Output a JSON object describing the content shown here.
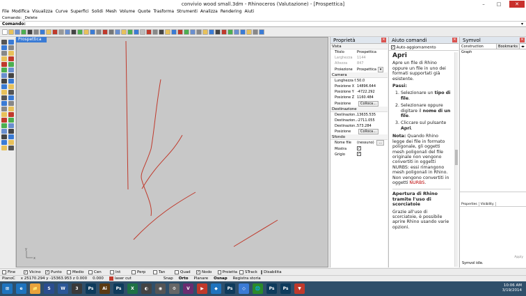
{
  "window": {
    "title": "convivio wood small.3dm - Rhinoceros (Valutazione) - [Prospettica]",
    "min": "–",
    "max": "□",
    "close": "✕"
  },
  "menu": [
    "File",
    "Modifica",
    "Visualizza",
    "Curve",
    "Superfici",
    "Solidi",
    "Mesh",
    "Volume",
    "Quote",
    "Trasforma",
    "Strumenti",
    "Analizza",
    "Rendering",
    "Aiuti"
  ],
  "command_history": [
    "Comando: _Delete"
  ],
  "command_prompt": "Comando:",
  "viewport": {
    "label": "Prospettica",
    "axis_y": "y",
    "axis_x": "x"
  },
  "proprieta": {
    "title": "Proprietà",
    "vista_label": "Vista",
    "vista_rows": [
      {
        "label": "Titolo",
        "value": "Prospettica",
        "disabled": false
      },
      {
        "label": "Larghezza",
        "value": "1144",
        "disabled": true
      },
      {
        "label": "Altezza",
        "value": "847",
        "disabled": true
      },
      {
        "label": "Proiezione",
        "value": "Prospettica",
        "disabled": false
      }
    ],
    "camera_label": "Camera",
    "camera_rows": [
      {
        "label": "Lunghezza f...",
        "value": "50.0"
      },
      {
        "label": "Posizione X",
        "value": "14896.644"
      },
      {
        "label": "Posizione Y",
        "value": "-4722.292"
      },
      {
        "label": "Posizione Z",
        "value": "1160.484"
      }
    ],
    "camera_pos_label": "Posizione",
    "colloca": "Colloca...",
    "destinazione_label": "Destinazione",
    "dest_rows": [
      {
        "label": "Destinazion...",
        "value": "13635.535"
      },
      {
        "label": "Destinazion...",
        "value": "-2711.055"
      },
      {
        "label": "Destinazion...",
        "value": "573.284"
      }
    ],
    "dest_pos_label": "Posizione",
    "sfondo_label": "Sfondo",
    "nome_file_label": "Nome file",
    "nome_file_value": "(nessuno)",
    "mostra_label": "Mostra",
    "grigio_label": "Grigio",
    "check": "✓",
    "dropdown": "▾",
    "browse": "..."
  },
  "aiuto": {
    "title": "Aiuto comandi",
    "auto_update": "Auto-aggiornamento",
    "heading": "Apri",
    "intro": "Apre un file di Rhino oppure un file in uno dei formati supportati già esistente.",
    "steps_label": "Passi:",
    "step1_a": "Selezionare un ",
    "step1_b": "tipo di file",
    "step1_c": ".",
    "step2_a": "Selezionare oppure digitare il ",
    "step2_b": "nome di un file",
    "step2_c": ".",
    "step3_a": "Cliccare sul pulsante ",
    "step3_b": "Apri",
    "step3_c": ".",
    "note_label": "Nota:",
    "note_text": " Quando Rhino legge dei file in formato poligonale, gli oggetti mesh poligonali del file originale non vengono convertiti in oggetti NURBS: essi rimangono mesh poligonali in Rhino. Non vengono convertiti in oggetti ",
    "note_nurbs": "NURBS",
    "note_end": ".",
    "section2": "Apertura di Rhino tramite l'uso di scorciatoie",
    "section2_text": "Grazie all'uso di scorciatoie, è possibile aprire Rhino usando varie opzioni."
  },
  "symvol": {
    "title": "Symvol",
    "tabs": [
      "Construction Graph",
      "Bookmarks"
    ],
    "sub_tabs": [
      "Properties",
      "Visibility"
    ],
    "apply": "Apply",
    "status": "Symvol idle."
  },
  "osnap": [
    {
      "label": "Fine",
      "checked": false
    },
    {
      "label": "Vicino",
      "checked": true
    },
    {
      "label": "Punto",
      "checked": true
    },
    {
      "label": "Medio",
      "checked": false
    },
    {
      "label": "Cen",
      "checked": false
    },
    {
      "label": "Int",
      "checked": false
    },
    {
      "label": "Perp",
      "checked": false
    },
    {
      "label": "Tan",
      "checked": false
    },
    {
      "label": "Quad",
      "checked": false
    },
    {
      "label": "Nodo",
      "checked": true
    },
    {
      "label": "Proietta",
      "checked": false
    },
    {
      "label": "STrack",
      "checked": false
    },
    {
      "label": "Disabilita",
      "checked": false
    }
  ],
  "status": {
    "cplane": "PianoC",
    "coords": "x 25170.294   y -15363.953 z 0.000",
    "value": "0.000",
    "layer": "laser cut",
    "snap": "Snap",
    "orto": "Orto",
    "planare": "Planare",
    "osnap": "Osnap",
    "registra": "Registra storia"
  },
  "taskbar": {
    "time": "10:06 AM",
    "date": "3/19/2014",
    "apps": [
      "e",
      "📁",
      "S",
      "W",
      "3",
      "Ps",
      "Ai",
      "Ps",
      "X",
      "◐",
      "◉",
      "⚙",
      "V",
      "▶",
      "◆",
      "Ps",
      "◇",
      "🌐",
      "Ps",
      "Ps",
      "▼"
    ]
  },
  "colors": {
    "curve": "#c0392b",
    "viewport_bg": "#c8c8c8",
    "accent": "#3a7bd5"
  }
}
